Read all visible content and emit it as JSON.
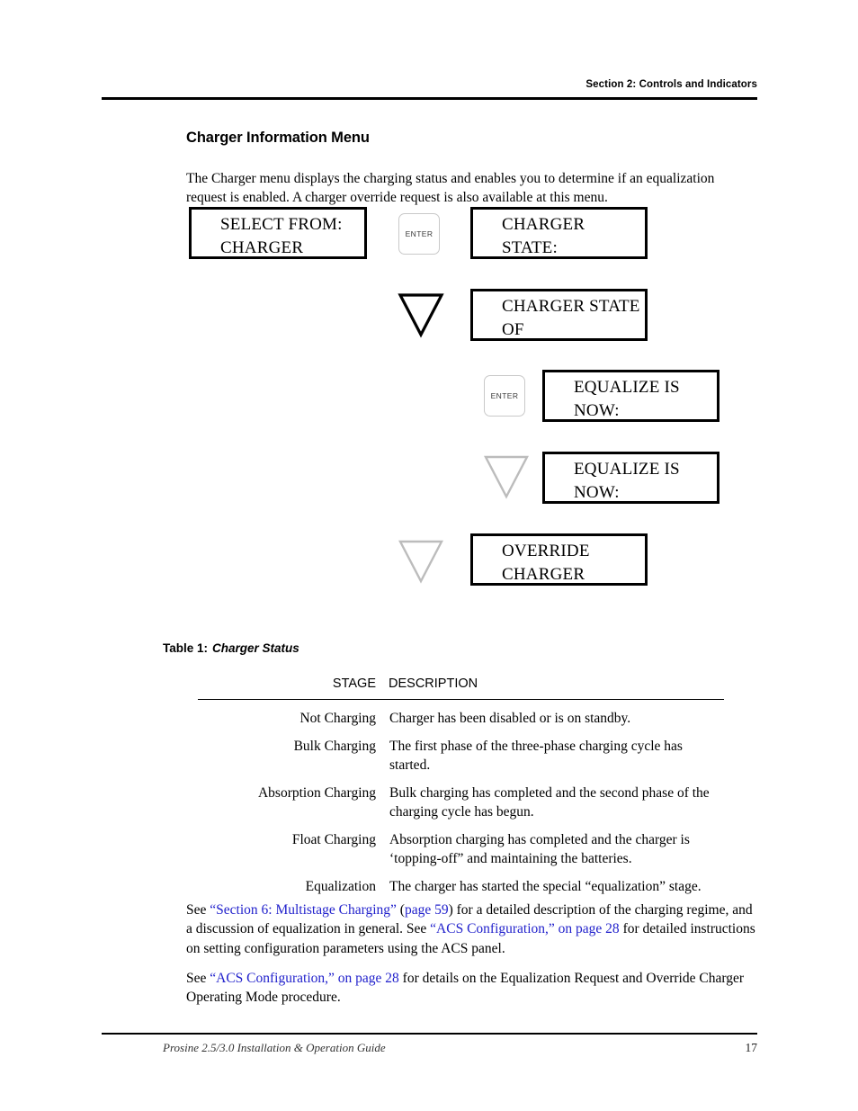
{
  "header": {
    "section_label": "Section 2: Controls and Indicators"
  },
  "page": {
    "title": "Charger Information Menu",
    "intro": "The Charger menu displays the charging status and enables you to determine if an equalization request is enabled. A charger override request is also available at this menu."
  },
  "diagram": {
    "enter_key_label": "ENTER",
    "nodes": [
      {
        "id": "select-from-charger",
        "line1": "SELECT FROM:",
        "line2": "CHARGER"
      },
      {
        "id": "charger-state",
        "line1": "CHARGER",
        "line2": "STATE:"
      },
      {
        "id": "charger-state-of",
        "line1": "CHARGER STATE",
        "line2": "OF"
      },
      {
        "id": "equalize-is-now-1",
        "line1": "EQUALIZE IS",
        "line2": "NOW:"
      },
      {
        "id": "equalize-is-now-2",
        "line1": "EQUALIZE IS",
        "line2": "NOW:"
      },
      {
        "id": "override-charger",
        "line1": "OVERRIDE",
        "line2": "CHARGER"
      }
    ]
  },
  "table": {
    "caption_label": "Table 1:",
    "caption_name": "Charger Status",
    "columns": [
      "STAGE",
      "DESCRIPTION"
    ],
    "rows": [
      {
        "stage": "Not Charging",
        "description": "Charger has been disabled or is on standby."
      },
      {
        "stage": "Bulk Charging",
        "description": "The first phase of the three-phase charging cycle has started."
      },
      {
        "stage": "Absorption Charging",
        "description": "Bulk charging has completed and the second phase of the charging cycle has begun."
      },
      {
        "stage": "Float Charging",
        "description": "Absorption charging has completed and the charger is ‘topping-off” and maintaining the batteries."
      },
      {
        "stage": "Equalization",
        "description": "The charger has started the special “equalization” stage."
      }
    ]
  },
  "closing": {
    "p1_a": "See ",
    "p1_link1": "“Section 6: Multistage Charging”",
    "p1_b": " (",
    "p1_link2": "page 59",
    "p1_c": ") for a detailed description of the charging regime, and a discussion of equalization in general. See ",
    "p1_link3": "“ACS Configuration,” on page 28",
    "p1_d": " for detailed instructions on setting configuration parameters using the ACS panel.",
    "p2_a": "See ",
    "p2_link1": "“ACS Configuration,” on page 28",
    "p2_b": " for details on the Equalization Request and Override Charger Operating Mode procedure."
  },
  "footer": {
    "guide_title": "Prosine 2.5/3.0 Installation & Operation Guide",
    "page_number": "17"
  },
  "colors": {
    "link": "#2222cc",
    "rule": "#000000",
    "triangle_dark": "#000000",
    "triangle_light": "#bcbcbc"
  }
}
